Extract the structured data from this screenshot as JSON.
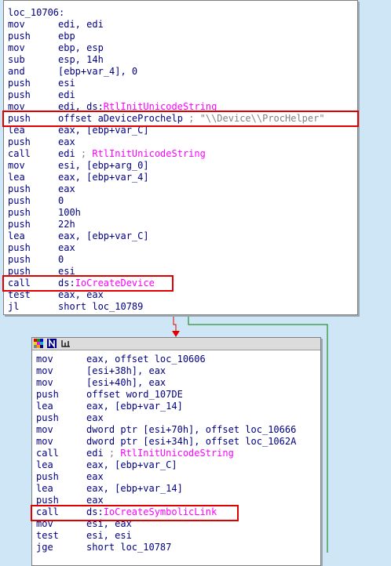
{
  "block1": {
    "label": "loc_10706:",
    "lines": [
      {
        "mn": "mov",
        "ops": "edi, edi"
      },
      {
        "mn": "push",
        "ops": "ebp"
      },
      {
        "mn": "mov",
        "ops": "ebp, esp"
      },
      {
        "mn": "sub",
        "ops": "esp, 14h"
      },
      {
        "mn": "and",
        "ops": "[ebp+var_4], 0"
      },
      {
        "mn": "push",
        "ops": "esi"
      },
      {
        "mn": "push",
        "ops": "edi"
      },
      {
        "mn": "mov",
        "ops": "edi, ds:",
        "sym": "RtlInitUnicodeString"
      },
      {
        "mn": "push",
        "ops": "offset aDeviceProchelp ",
        "cmt": "; ",
        "str": "\"\\\\Device\\\\ProcHelper\""
      },
      {
        "mn": "lea",
        "ops": "eax, [ebp+var_C]"
      },
      {
        "mn": "push",
        "ops": "eax"
      },
      {
        "mn": "call",
        "ops": "edi ",
        "cmt": "; ",
        "sym": "RtlInitUnicodeString"
      },
      {
        "mn": "mov",
        "ops": "esi, [ebp+arg_0]"
      },
      {
        "mn": "lea",
        "ops": "eax, [ebp+var_4]"
      },
      {
        "mn": "push",
        "ops": "eax"
      },
      {
        "mn": "push",
        "ops": "0"
      },
      {
        "mn": "push",
        "ops": "100h"
      },
      {
        "mn": "push",
        "ops": "22h"
      },
      {
        "mn": "lea",
        "ops": "eax, [ebp+var_C]"
      },
      {
        "mn": "push",
        "ops": "eax"
      },
      {
        "mn": "push",
        "ops": "0"
      },
      {
        "mn": "push",
        "ops": "esi"
      },
      {
        "mn": "call",
        "ops": "ds:",
        "sym": "IoCreateDevice"
      },
      {
        "mn": "test",
        "ops": "eax, eax"
      },
      {
        "mn": "jl",
        "ops": "short loc_10789"
      }
    ]
  },
  "block2": {
    "lines": [
      {
        "mn": "mov",
        "ops": "eax, offset loc_10606"
      },
      {
        "mn": "mov",
        "ops": "[esi+38h], eax"
      },
      {
        "mn": "mov",
        "ops": "[esi+40h], eax"
      },
      {
        "mn": "push",
        "ops": "offset word_107DE"
      },
      {
        "mn": "lea",
        "ops": "eax, [ebp+var_14]"
      },
      {
        "mn": "push",
        "ops": "eax"
      },
      {
        "mn": "mov",
        "ops": "dword ptr [esi+70h], offset loc_10666"
      },
      {
        "mn": "mov",
        "ops": "dword ptr [esi+34h], offset loc_1062A"
      },
      {
        "mn": "call",
        "ops": "edi ",
        "cmt": "; ",
        "sym": "RtlInitUnicodeString"
      },
      {
        "mn": "lea",
        "ops": "eax, [ebp+var_C]"
      },
      {
        "mn": "push",
        "ops": "eax"
      },
      {
        "mn": "lea",
        "ops": "eax, [ebp+var_14]"
      },
      {
        "mn": "push",
        "ops": "eax"
      },
      {
        "mn": "call",
        "ops": "ds:",
        "sym": "IoCreateSymbolicLink"
      },
      {
        "mn": "mov",
        "ops": "esi, eax"
      },
      {
        "mn": "test",
        "ops": "esi, esi"
      },
      {
        "mn": "jge",
        "ops": "short loc_10787"
      }
    ]
  },
  "colors": {
    "background": "#cfe6f7",
    "highlight": "#e00000",
    "edge_false": "#e00000",
    "edge_true": "#008000",
    "symbol": "#ff00ff",
    "mnemonic": "#000080",
    "comment": "#808080"
  },
  "icons": [
    "color-palette-icon",
    "graph-n-icon",
    "graph-overview-icon"
  ]
}
